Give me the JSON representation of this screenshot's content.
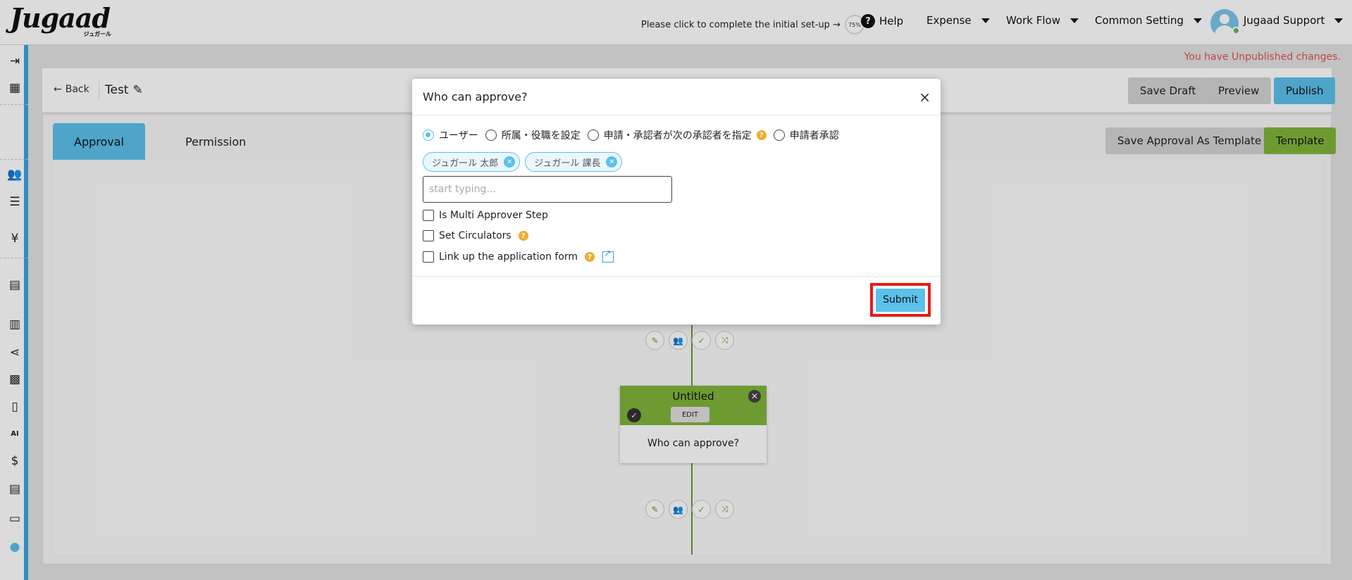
{
  "header": {
    "logo_text": "Jugaad",
    "logo_sub": "ジュガール",
    "setup_text": "Please click to complete the initial set-up →",
    "setup_progress": "75%",
    "help_label": "Help",
    "nav": [
      "Expense",
      "Work Flow",
      "Common Setting"
    ],
    "user_name": "Jugaad Support"
  },
  "sidebar": {
    "icons": [
      "collapse-icon",
      "building-icon",
      "users-icon",
      "list-icon",
      "yen-icon",
      "document-icon",
      "receipt-icon",
      "share-icon",
      "grid-icon",
      "book-icon",
      "ai-icon",
      "invoice-icon",
      "library-icon",
      "manual-icon",
      "palette-icon"
    ]
  },
  "page": {
    "unpublished_notice": "You have Unpublished changes.",
    "back_label": "Back",
    "title": "Test",
    "save_draft": "Save Draft",
    "preview": "Preview",
    "publish": "Publish",
    "tabs": [
      "Approval",
      "Permission"
    ],
    "save_template": "Save Approval As Template",
    "template": "Template"
  },
  "node": {
    "title": "Untitled",
    "edit_label": "EDIT",
    "body": "Who can approve?"
  },
  "modal": {
    "title": "Who can approve?",
    "radios": [
      "ユーザー",
      "所属・役職を設定",
      "申請・承認者が次の承認者を指定",
      "申請者承認"
    ],
    "chips": [
      "ジュガール 太郎",
      "ジュガール 課長"
    ],
    "input_placeholder": "start typing...",
    "checks": [
      "Is Multi Approver Step",
      "Set Circulators",
      "Link up the application form"
    ],
    "submit": "Submit"
  },
  "colors": {
    "accent_blue": "#5bc0eb",
    "accent_green": "#7fb53b",
    "highlight_red": "#e41c1c"
  }
}
